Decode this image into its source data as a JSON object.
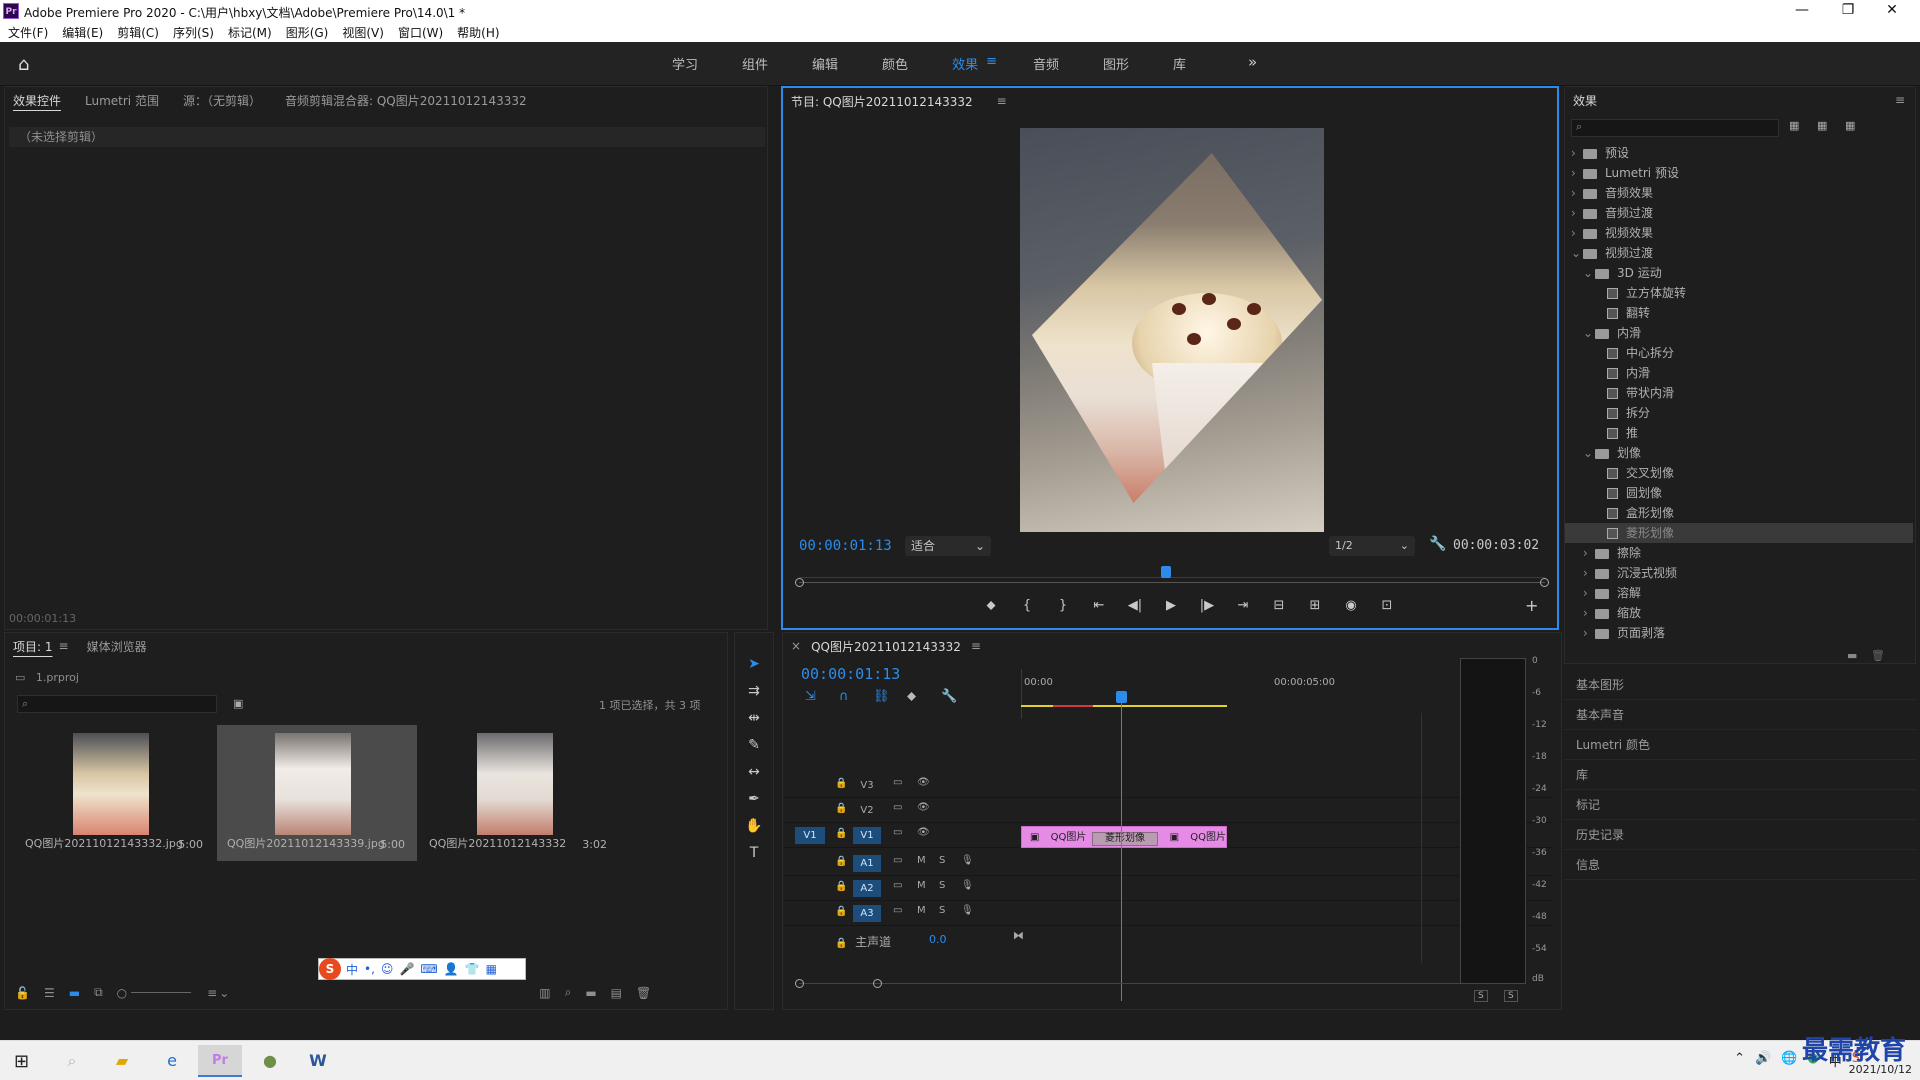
{
  "titlebar": {
    "title": "Adobe Premiere Pro 2020 - C:\\用户\\hbxy\\文档\\Adobe\\Premiere Pro\\14.0\\1 *",
    "minimize": "—",
    "maximize": "❐",
    "close": "✕"
  },
  "menu": [
    "文件(F)",
    "编辑(E)",
    "剪辑(C)",
    "序列(S)",
    "标记(M)",
    "图形(G)",
    "视图(V)",
    "窗口(W)",
    "帮助(H)"
  ],
  "workspaces": {
    "items": [
      "学习",
      "组件",
      "编辑",
      "颜色",
      "效果",
      "音频",
      "图形",
      "库"
    ],
    "active": "效果",
    "more": "»"
  },
  "effect_controls": {
    "tabs": [
      "效果控件",
      "Lumetri 范围",
      "源：（无剪辑）",
      "音频剪辑混合器: QQ图片20211012143332"
    ],
    "no_clip": "（未选择剪辑）",
    "timecode": "00:00:01:13"
  },
  "program": {
    "title": "节目: QQ图片20211012143332",
    "timecode": "00:00:01:13",
    "fit": "适合",
    "resolution": "1/2",
    "duration": "00:00:03:02",
    "controls": [
      "⬥",
      "{",
      "}",
      "⇤",
      "◀|",
      "▶",
      "|▶",
      "⇥",
      "⊟",
      "⊞",
      "◉",
      "⊡"
    ],
    "add": "+"
  },
  "effects": {
    "title": "效果",
    "search_placeholder": "",
    "tree": [
      {
        "label": "预设",
        "indent": 0,
        "kind": "folder",
        "chev": "›"
      },
      {
        "label": "Lumetri 预设",
        "indent": 0,
        "kind": "folder",
        "chev": "›"
      },
      {
        "label": "音频效果",
        "indent": 0,
        "kind": "folder",
        "chev": "›"
      },
      {
        "label": "音频过渡",
        "indent": 0,
        "kind": "folder",
        "chev": "›"
      },
      {
        "label": "视频效果",
        "indent": 0,
        "kind": "folder",
        "chev": "›"
      },
      {
        "label": "视频过渡",
        "indent": 0,
        "kind": "folder",
        "chev": "⌄"
      },
      {
        "label": "3D 运动",
        "indent": 1,
        "kind": "folder",
        "chev": "⌄"
      },
      {
        "label": "立方体旋转",
        "indent": 2,
        "kind": "fx",
        "chev": ""
      },
      {
        "label": "翻转",
        "indent": 2,
        "kind": "fx",
        "chev": ""
      },
      {
        "label": "内滑",
        "indent": 1,
        "kind": "folder",
        "chev": "⌄"
      },
      {
        "label": "中心拆分",
        "indent": 2,
        "kind": "fx",
        "chev": ""
      },
      {
        "label": "内滑",
        "indent": 2,
        "kind": "fx",
        "chev": ""
      },
      {
        "label": "带状内滑",
        "indent": 2,
        "kind": "fx",
        "chev": ""
      },
      {
        "label": "拆分",
        "indent": 2,
        "kind": "fx",
        "chev": ""
      },
      {
        "label": "推",
        "indent": 2,
        "kind": "fx",
        "chev": ""
      },
      {
        "label": "划像",
        "indent": 1,
        "kind": "folder",
        "chev": "⌄"
      },
      {
        "label": "交叉划像",
        "indent": 2,
        "kind": "fx",
        "chev": ""
      },
      {
        "label": "圆划像",
        "indent": 2,
        "kind": "fx",
        "chev": ""
      },
      {
        "label": "盒形划像",
        "indent": 2,
        "kind": "fx",
        "chev": ""
      },
      {
        "label": "菱形划像",
        "indent": 2,
        "kind": "fx",
        "chev": "",
        "selected": true
      },
      {
        "label": "擦除",
        "indent": 1,
        "kind": "folder",
        "chev": "›"
      },
      {
        "label": "沉浸式视频",
        "indent": 1,
        "kind": "folder",
        "chev": "›"
      },
      {
        "label": "溶解",
        "indent": 1,
        "kind": "folder",
        "chev": "›"
      },
      {
        "label": "缩放",
        "indent": 1,
        "kind": "folder",
        "chev": "›"
      },
      {
        "label": "页面剥落",
        "indent": 1,
        "kind": "folder",
        "chev": "›"
      }
    ],
    "side_panels": [
      "基本图形",
      "基本声音",
      "Lumetri 颜色",
      "库",
      "标记",
      "历史记录",
      "信息"
    ]
  },
  "project": {
    "tabs": [
      "项目: 1",
      "媒体浏览器"
    ],
    "file": "1.prproj",
    "selection_count": "1 项已选择，共 3 项",
    "items": [
      {
        "name": "QQ图片20211012143332.jpg",
        "duration": "5:00"
      },
      {
        "name": "QQ图片20211012143339.jpg",
        "duration": "5:00"
      },
      {
        "name": "QQ图片20211012143332",
        "duration": "3:02"
      }
    ]
  },
  "ime": {
    "logo": "S",
    "labels": [
      "中",
      "•,",
      "☺",
      "🎤",
      "⌨",
      "👤",
      "👕",
      "▦"
    ]
  },
  "timeline": {
    "title": "QQ图片20211012143332",
    "timecode": "00:00:01:13",
    "ruler": [
      "00:00",
      "00:00:05:00"
    ],
    "tracks": [
      {
        "name": "V3",
        "type": "video"
      },
      {
        "name": "V2",
        "type": "video"
      },
      {
        "name": "V1",
        "type": "video",
        "on": true,
        "src": "V1"
      },
      {
        "name": "A1",
        "type": "audio",
        "on": true
      },
      {
        "name": "A2",
        "type": "audio",
        "on": true
      },
      {
        "name": "A3",
        "type": "audio",
        "on": true
      }
    ],
    "clip1": "QQ图片",
    "clip2": "QQ图片",
    "transition": "菱形划像",
    "master_label": "主声道",
    "master_value": "0.0",
    "mute": "M",
    "solo": "S"
  },
  "meter": {
    "ticks": [
      "0",
      "-6",
      "-12",
      "-18",
      "-24",
      "-30",
      "-36",
      "-42",
      "-48",
      "-54",
      "dB"
    ],
    "solo": [
      "S",
      "S"
    ]
  },
  "taskbar": {
    "date": "2021/10/12",
    "watermark": "最需教育"
  }
}
